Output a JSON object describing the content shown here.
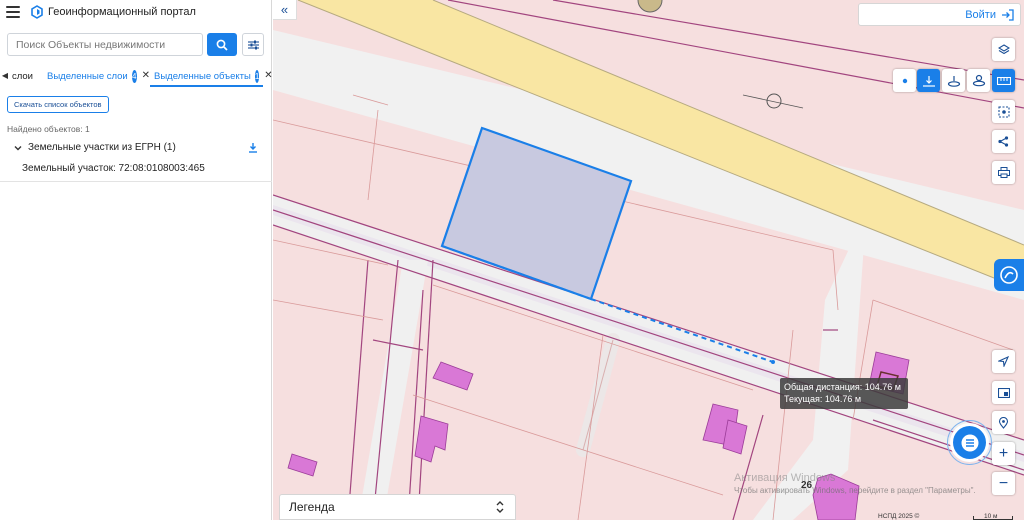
{
  "app": {
    "title": "Геоинформационный портал"
  },
  "search": {
    "placeholder": "Поиск Объекты недвижимости",
    "value": ""
  },
  "tabs": [
    {
      "label": "слои"
    },
    {
      "label": "Выделенные слои",
      "badge": "4"
    },
    {
      "label": "Выделенные объекты",
      "badge": "1"
    }
  ],
  "results": {
    "download_button": "Скачать список объектов",
    "found_label": "Найдено объектов: 1",
    "group_label": "Земельные участки из ЕГРН (1)",
    "item_label": "Земельный участок: 72:08:0108003:465"
  },
  "map": {
    "login_label": "Войти",
    "measure_tooltip": {
      "total": "Общая дистанция: 104.76 м",
      "current": "Текущая: 104.76 м"
    },
    "legend_label": "Легенда",
    "parcel_number": "26",
    "watermark_title": "Активация Windows",
    "watermark_sub": "Чтобы активировать Windows, перейдите в раздел \"Параметры\".",
    "copyright": "НСПД 2025 ©",
    "scale_label": "10 м"
  },
  "colors": {
    "accent": "#1a7fe8",
    "parcel_fill": "#f6dfdf",
    "road_yellow": "#f9e6a3",
    "building": "#d978d6",
    "selected_parcel": "#c8c9e0",
    "boundary": "#a2457f"
  },
  "icons": {
    "menu": "hamburger-icon",
    "search": "search-icon",
    "filter": "sliders-icon",
    "layers": "layers-icon",
    "ruler": "ruler-icon",
    "share": "share-icon",
    "print": "printer-icon",
    "locate": "navigation-arrow-icon",
    "chat": "chat-lines-icon"
  }
}
